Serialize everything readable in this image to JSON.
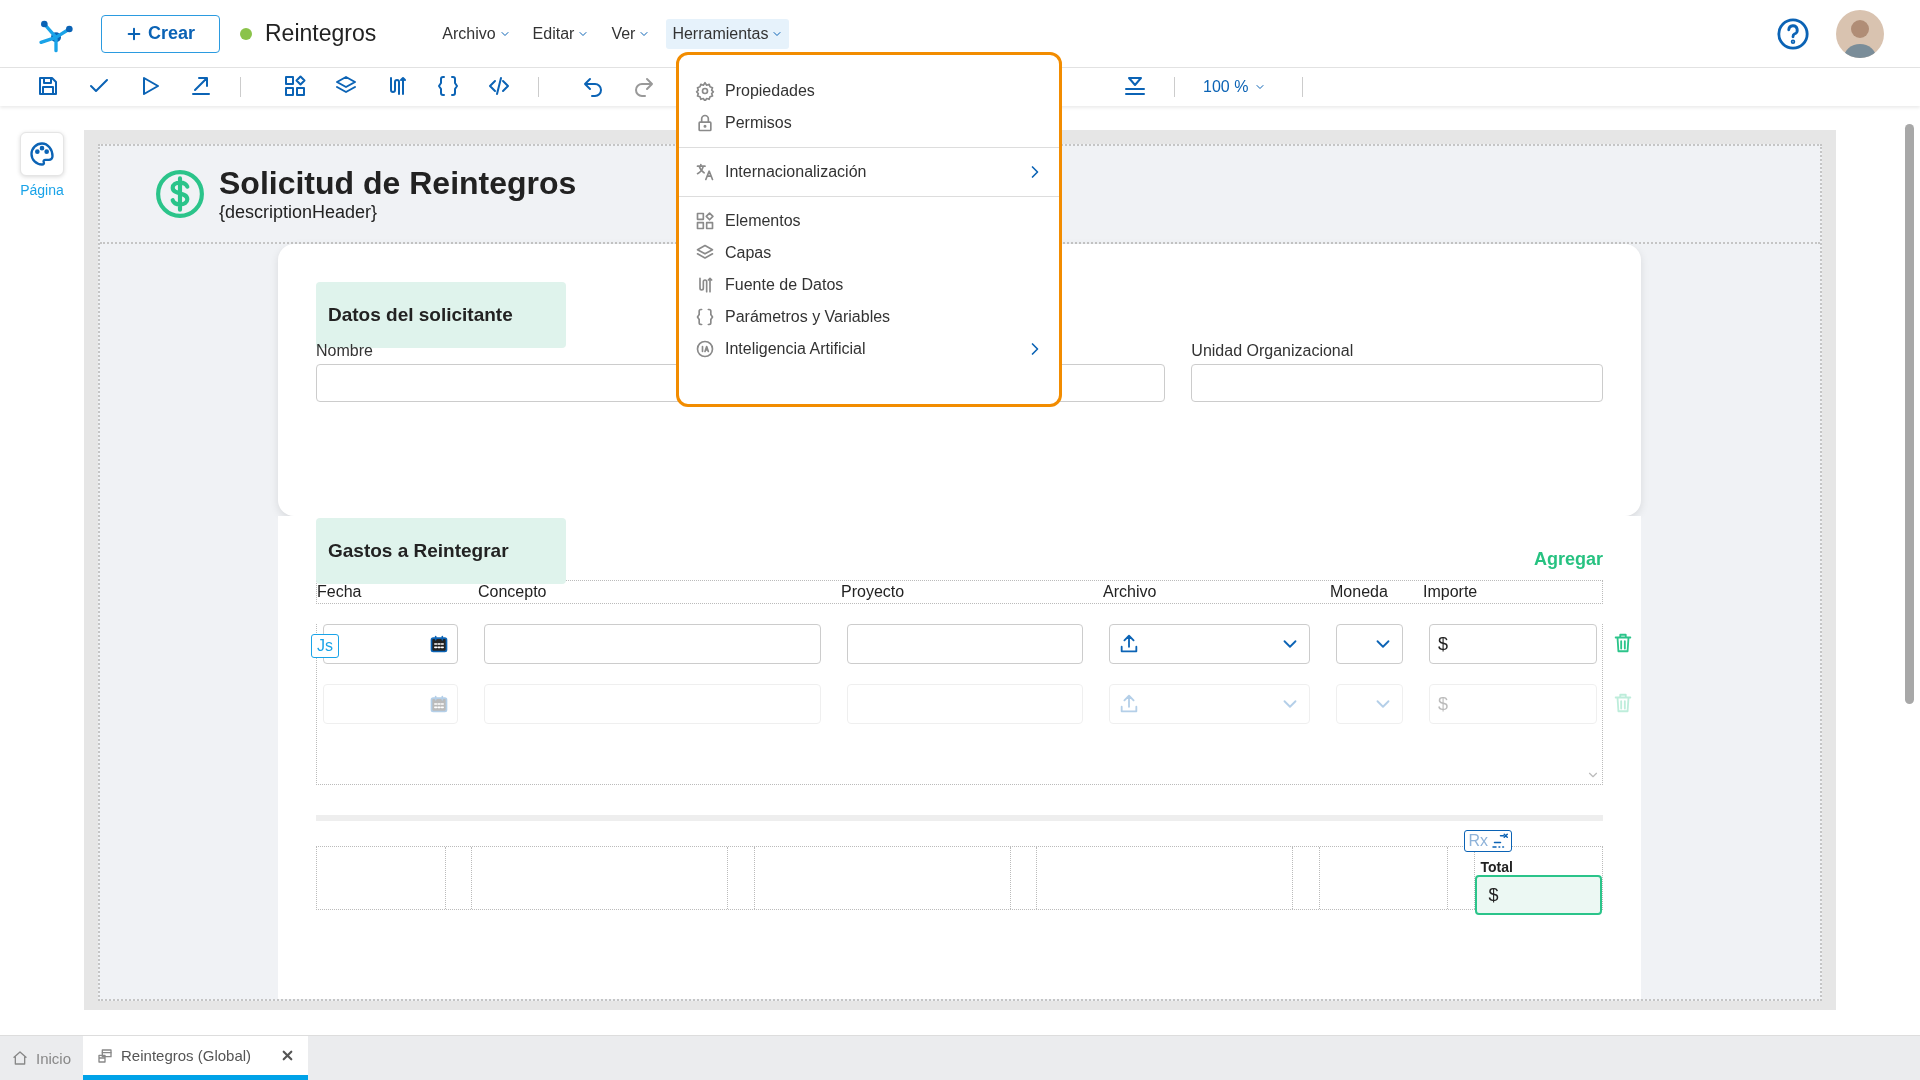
{
  "header": {
    "create_button": "Crear",
    "document_name": "Reintegros",
    "menus": [
      {
        "label": "Archivo",
        "selected": false
      },
      {
        "label": "Editar",
        "selected": false
      },
      {
        "label": "Ver",
        "selected": false
      },
      {
        "label": "Herramientas",
        "selected": true
      }
    ]
  },
  "toolbar": {
    "zoom": "100 %"
  },
  "tools_menu": {
    "groups": [
      {
        "items": [
          {
            "label": "Propiedades",
            "submenu": false
          },
          {
            "label": "Permisos",
            "submenu": false
          }
        ]
      },
      {
        "items": [
          {
            "label": "Internacionalización",
            "submenu": true
          }
        ]
      },
      {
        "items": [
          {
            "label": "Elementos",
            "submenu": false
          },
          {
            "label": "Capas",
            "submenu": false
          },
          {
            "label": "Fuente de Datos",
            "submenu": false
          },
          {
            "label": "Parámetros y Variables",
            "submenu": false
          },
          {
            "label": "Inteligencia Artificial",
            "submenu": true
          }
        ]
      }
    ]
  },
  "side_panel": {
    "label": "Página"
  },
  "form": {
    "title": "Solicitud de Reintegros",
    "description": "{descriptionHeader}",
    "applicant": {
      "title": "Datos del solicitante",
      "fields": [
        {
          "label": "Nombre"
        },
        {
          "label": "Unidad Organizacional"
        }
      ]
    },
    "expenses": {
      "title": "Gastos a Reintegrar",
      "add_link": "Agregar",
      "script_badge": "Js",
      "columns": [
        "Fecha",
        "Concepto",
        "Proyecto",
        "Archivo",
        "Moneda",
        "Importe"
      ],
      "rows": [
        {
          "disabled": false,
          "amount": "$"
        },
        {
          "disabled": true,
          "amount": "$"
        }
      ]
    },
    "total": {
      "badge": "Rx",
      "label": "Total",
      "amount": "$"
    }
  },
  "tabs": [
    {
      "label": "Inicio",
      "selected": false,
      "closable": false
    },
    {
      "label": "Reintegros (Global)",
      "selected": true,
      "closable": true
    }
  ]
}
